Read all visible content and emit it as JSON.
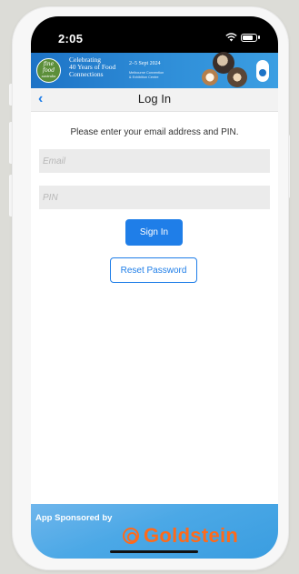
{
  "status_bar": {
    "time": "2:05"
  },
  "banner": {
    "logo_line1": "fine food",
    "logo_line2": "australia",
    "headline_line1": "Celebrating",
    "headline_line2": "40 Years of Food",
    "headline_line3": "Connections",
    "date": "2–5 Sept 2024",
    "venue_line1": "Melbourne Convention",
    "venue_line2": "& Exhibition Centre"
  },
  "nav": {
    "back_icon": "chevron-left-icon",
    "title": "Log In"
  },
  "form": {
    "prompt": "Please enter your email address and PIN.",
    "email_placeholder": "Email",
    "pin_placeholder": "PIN",
    "sign_in_label": "Sign In",
    "reset_label": "Reset Password"
  },
  "footer": {
    "sponsor_label": "App Sponsored by",
    "sponsor_name": "Goldstein"
  },
  "colors": {
    "accent": "#1f7ee8",
    "sponsor_orange": "#ff6a1a",
    "banner_blue": "#1d73c6"
  }
}
